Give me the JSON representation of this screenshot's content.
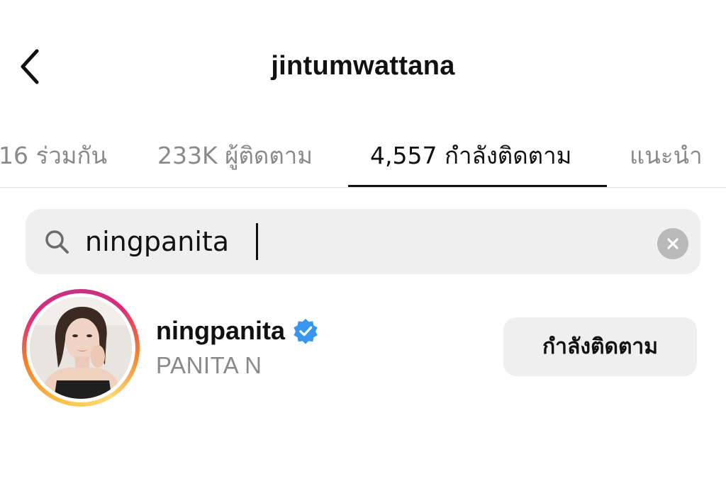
{
  "header": {
    "title": "jintumwattana",
    "back_icon": "chevron-left-icon"
  },
  "tabs": [
    {
      "label": "16 ร่วมกัน",
      "active": false
    },
    {
      "label": "233K ผู้ติดตาม",
      "active": false
    },
    {
      "label": "4,557 กำลังติดตาม",
      "active": true
    },
    {
      "label": "แนะนำ",
      "active": false
    }
  ],
  "search": {
    "value": "ningpanita",
    "search_icon": "search-icon",
    "clear_icon": "clear-icon"
  },
  "result": {
    "username": "ningpanita",
    "verified": true,
    "full_name": "PANITA N",
    "follow_button_label": "กำลังติดตาม",
    "has_story_ring": true
  },
  "colors": {
    "verified_blue": "#3797f0",
    "inactive_text": "#8a8a8a",
    "search_bg": "#efefef",
    "button_bg": "#efefef"
  }
}
